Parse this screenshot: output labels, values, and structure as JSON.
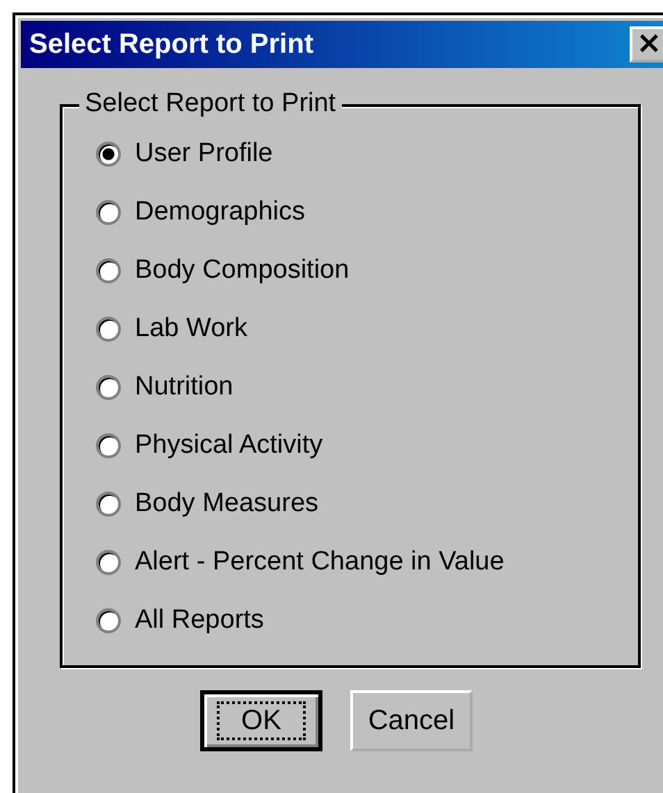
{
  "window": {
    "title": "Select Report to Print",
    "close": "×"
  },
  "group": {
    "label": "Select Report to Print",
    "options": [
      {
        "label": "User Profile",
        "selected": true
      },
      {
        "label": "Demographics",
        "selected": false
      },
      {
        "label": "Body Composition",
        "selected": false
      },
      {
        "label": "Lab Work",
        "selected": false
      },
      {
        "label": "Nutrition",
        "selected": false
      },
      {
        "label": "Physical Activity",
        "selected": false
      },
      {
        "label": "Body Measures",
        "selected": false
      },
      {
        "label": "Alert - Percent Change in Value",
        "selected": false
      },
      {
        "label": "All Reports",
        "selected": false
      }
    ]
  },
  "buttons": [
    {
      "label": "OK",
      "default": true
    },
    {
      "label": "Cancel",
      "default": false
    }
  ]
}
